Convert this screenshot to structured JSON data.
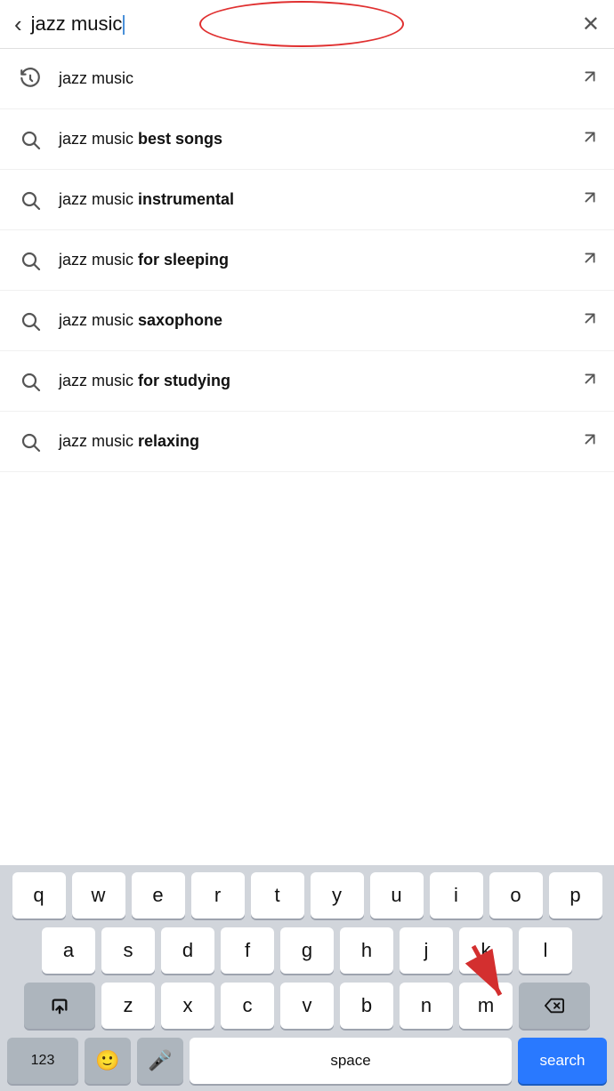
{
  "searchBar": {
    "back_label": "‹",
    "query": "jazz music",
    "close_label": "×"
  },
  "suggestions": [
    {
      "type": "history",
      "text_plain": "jazz music",
      "text_bold": ""
    },
    {
      "type": "search",
      "text_plain": "jazz music ",
      "text_bold": "best songs"
    },
    {
      "type": "search",
      "text_plain": "jazz music ",
      "text_bold": "instrumental"
    },
    {
      "type": "search",
      "text_plain": "jazz music ",
      "text_bold": "for sleeping"
    },
    {
      "type": "search",
      "text_plain": "jazz music ",
      "text_bold": "saxophone"
    },
    {
      "type": "search",
      "text_plain": "jazz music ",
      "text_bold": "for studying"
    },
    {
      "type": "search",
      "text_plain": "jazz music ",
      "text_bold": "relaxing"
    }
  ],
  "keyboard": {
    "rows": [
      [
        "q",
        "w",
        "e",
        "r",
        "t",
        "y",
        "u",
        "i",
        "o",
        "p"
      ],
      [
        "a",
        "s",
        "d",
        "f",
        "g",
        "h",
        "j",
        "k",
        "l"
      ],
      [
        "z",
        "x",
        "c",
        "v",
        "b",
        "n",
        "m"
      ]
    ],
    "num_label": "123",
    "space_label": "space",
    "search_label": "search"
  },
  "colors": {
    "accent_blue": "#2979ff",
    "oval_red": "#e03030",
    "arrow_red": "#d32f2f"
  }
}
